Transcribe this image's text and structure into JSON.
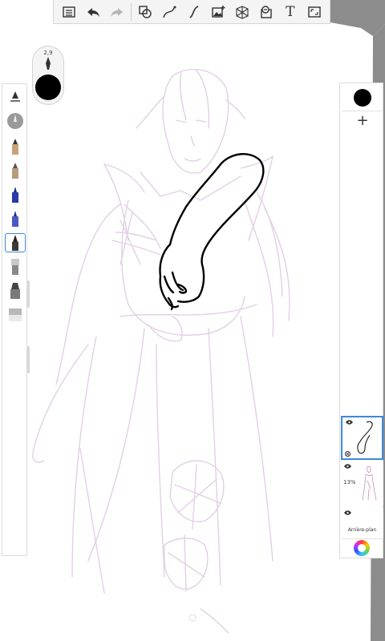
{
  "toolbar": {
    "tools": [
      {
        "name": "menu-icon"
      },
      {
        "name": "undo-icon"
      },
      {
        "name": "redo-icon"
      },
      {
        "name": "selection-shapes-icon"
      },
      {
        "name": "stroke-curve-icon"
      },
      {
        "name": "french-curve-icon"
      },
      {
        "name": "add-image-icon"
      },
      {
        "name": "perspective-grid-icon"
      },
      {
        "name": "symmetry-icon"
      },
      {
        "name": "text-icon",
        "label": "T"
      },
      {
        "name": "fullscreen-icon"
      }
    ]
  },
  "brush_puck": {
    "size": "2,9",
    "color": "#000000"
  },
  "brush_panel": {
    "brushes": [
      {
        "name": "brush-settings-icon"
      },
      {
        "name": "airbrush-icon"
      },
      {
        "name": "pencil-icon"
      },
      {
        "name": "hard-pencil-icon"
      },
      {
        "name": "ink-pen-icon"
      },
      {
        "name": "ballpoint-pen-icon"
      },
      {
        "name": "fountain-pen-icon",
        "selected": true
      },
      {
        "name": "paintbrush-icon"
      },
      {
        "name": "marker-icon"
      },
      {
        "name": "eraser-icon"
      }
    ]
  },
  "layers": {
    "current_color": "#000000",
    "add_label": "+",
    "items": [
      {
        "name": "layer-1",
        "opacity": "",
        "selected": true
      },
      {
        "name": "layer-2",
        "opacity": "13%"
      },
      {
        "name": "layer-background",
        "label": "Arrière-plan"
      }
    ]
  },
  "colors": {
    "accent": "#3b8ad9",
    "sketch": "#e3cfe6",
    "ink": "#000000"
  }
}
